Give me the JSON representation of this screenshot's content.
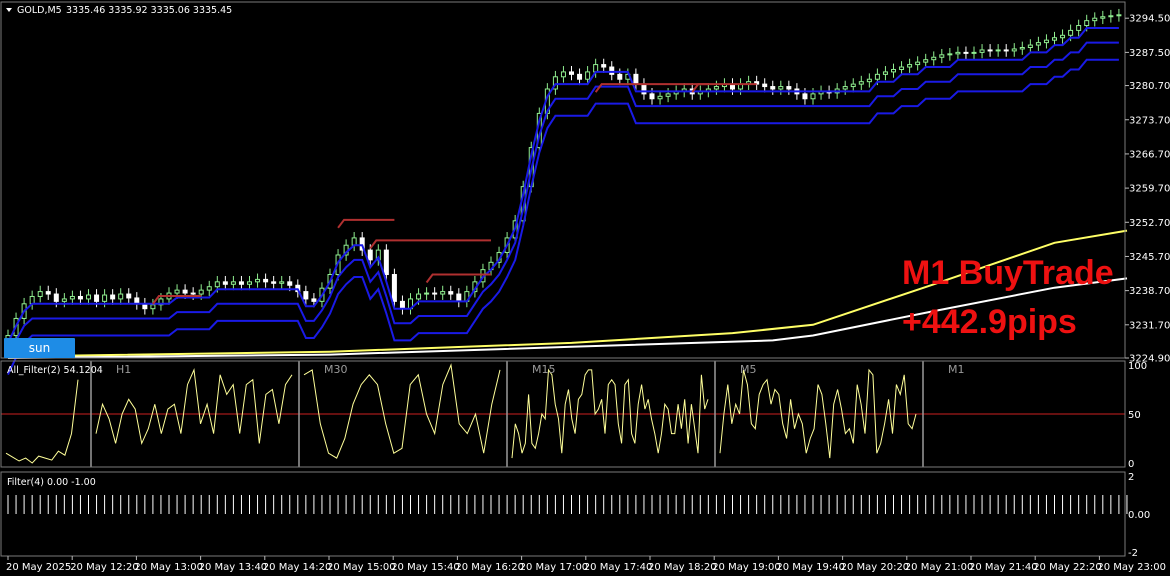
{
  "chart_header": {
    "symbol": "GOLD,M5",
    "ohlc": "3335.46 3335.92 3335.06 3335.45"
  },
  "overlay": {
    "line1": "M1 BuyTrade",
    "line2": "+442.9pips",
    "color": "#ee1111"
  },
  "sun_button": "sun",
  "colors": {
    "background": "#000000",
    "bull_candle": "#90ee90",
    "bear_candle": "#ffffff",
    "channel": "#1a1ae6",
    "channel_stop": "#b03030",
    "ma_slow_yellow": "#ffff66",
    "ma_slow_white": "#ffffff",
    "oscillator": "#ffff99",
    "oscillator_midline": "#cc2020"
  },
  "chart_data": [
    {
      "type": "line",
      "panel": "main",
      "price_axis": [
        "3294.50",
        "3287.50",
        "3280.70",
        "3273.70",
        "3266.70",
        "3259.70",
        "3252.70",
        "3245.70",
        "3238.70",
        "3231.70",
        "3224.90"
      ],
      "ylim": [
        3224.9,
        3297.0
      ],
      "time_axis": [
        "20 May 2025",
        "20 May 12:20",
        "20 May 13:00",
        "20 May 13:40",
        "20 May 14:20",
        "20 May 15:00",
        "20 May 15:40",
        "20 May 16:20",
        "20 May 17:00",
        "20 May 17:40",
        "20 May 18:20",
        "20 May 19:00",
        "20 May 19:40",
        "20 May 20:20",
        "20 May 21:00",
        "20 May 21:40",
        "20 May 22:20",
        "20 May 23:00"
      ],
      "candles_close": [
        3229.5,
        3233,
        3236,
        3237.5,
        3238.5,
        3238,
        3236.5,
        3237,
        3237.5,
        3237,
        3237.8,
        3236.5,
        3237.8,
        3237,
        3238,
        3237.2,
        3236,
        3235,
        3235.8,
        3237,
        3238.2,
        3238.8,
        3238.2,
        3238,
        3238.8,
        3239.5,
        3240.5,
        3240,
        3240.5,
        3240,
        3240.5,
        3241,
        3240.5,
        3240.2,
        3240.5,
        3239.8,
        3238.5,
        3237,
        3236.5,
        3239.2,
        3242,
        3246,
        3248,
        3249.5,
        3247,
        3245,
        3247,
        3242,
        3236.5,
        3235,
        3237,
        3238,
        3238.2,
        3238,
        3238.5,
        3238,
        3236.5,
        3238.5,
        3240.5,
        3243,
        3244.5,
        3246.5,
        3249.5,
        3253,
        3260,
        3268,
        3275,
        3280,
        3282.5,
        3283.5,
        3283,
        3282,
        3283.5,
        3285,
        3284.5,
        3283,
        3282,
        3283,
        3281,
        3279,
        3278,
        3278.5,
        3279,
        3279.5,
        3280,
        3279,
        3279.5,
        3280,
        3280.5,
        3281,
        3280,
        3281,
        3281.5,
        3281,
        3280.5,
        3280,
        3280.5,
        3280,
        3279,
        3278,
        3279,
        3279.5,
        3279.2,
        3280,
        3280.5,
        3281,
        3281.5,
        3282,
        3283,
        3283.5,
        3284,
        3284.5,
        3285,
        3285.5,
        3286,
        3286.5,
        3287,
        3287.2,
        3287.5,
        3287.3,
        3287.5,
        3288,
        3287.8,
        3288,
        3287.8,
        3288.2,
        3288.5,
        3289,
        3289.5,
        3290,
        3290.5,
        3291,
        3292,
        3293,
        3294,
        3294.5,
        3294.8,
        3295,
        3295.2
      ],
      "series": [
        {
          "name": "",
          "role": "ma-yellow",
          "points": [
            [
              0,
              3225.2
            ],
            [
              40,
              3226.2
            ],
            [
              70,
              3228
            ],
            [
              90,
              3230
            ],
            [
              100,
              3231.7
            ],
            [
              115,
              3240
            ],
            [
              130,
              3248.5
            ],
            [
              139,
              3251
            ]
          ]
        },
        {
          "name": "",
          "role": "ma-white",
          "points": [
            [
              0,
              3224.9
            ],
            [
              40,
              3225.6
            ],
            [
              70,
              3227.2
            ],
            [
              95,
              3228.5
            ],
            [
              100,
              3229.5
            ],
            [
              115,
              3234.5
            ],
            [
              130,
              3239.3
            ],
            [
              139,
              3241.2
            ]
          ]
        }
      ]
    },
    {
      "type": "line",
      "panel": "All_Filter",
      "title": "All_Filter(2) 54.1204",
      "timeframes": [
        "H1",
        "M30",
        "M15",
        "M5",
        "M1"
      ],
      "y_axis": [
        "100",
        "50",
        "0"
      ],
      "ylim": [
        0,
        100
      ],
      "midline": 50,
      "series": [
        {
          "name": "",
          "values": [
            10,
            6,
            2,
            5,
            0,
            7,
            5,
            3,
            12,
            8,
            30,
            85
          ]
        },
        {
          "name": "",
          "values": [
            30,
            60,
            45,
            20,
            50,
            65,
            55,
            20,
            35,
            60,
            30,
            55,
            60,
            30,
            80,
            95,
            40,
            60,
            30,
            90,
            70,
            80,
            30,
            80,
            85,
            20,
            70,
            75,
            40,
            80,
            90
          ]
        },
        {
          "name": "",
          "values": [
            90,
            95,
            40,
            10,
            5,
            25,
            60,
            80,
            90,
            80,
            40,
            10,
            15,
            80,
            90,
            50,
            30,
            80,
            100,
            40,
            30,
            50,
            10,
            60,
            95
          ]
        },
        {
          "name": "",
          "values": [
            5,
            40,
            30,
            10,
            20,
            70,
            20,
            15,
            30,
            50,
            45,
            95,
            90,
            60,
            45,
            10,
            60,
            75,
            45,
            30,
            65,
            70,
            90,
            95,
            95,
            50,
            55,
            65,
            30,
            80,
            85,
            80,
            40,
            20,
            80,
            85,
            30,
            20,
            60,
            80,
            55,
            65,
            45,
            30,
            10,
            30,
            60,
            55,
            30,
            30,
            60,
            35,
            65,
            20,
            60,
            35,
            10,
            90,
            55,
            65
          ]
        },
        {
          "name": "",
          "values": [
            10,
            50,
            80,
            40,
            60,
            50,
            95,
            80,
            40,
            35,
            70,
            80,
            85,
            60,
            75,
            70,
            40,
            25,
            65,
            35,
            50,
            40,
            10,
            25,
            35,
            80,
            70,
            40,
            5,
            60,
            75,
            55,
            30,
            35,
            20,
            80,
            60,
            30,
            95,
            90,
            10,
            20,
            40,
            65,
            30,
            80,
            70,
            90,
            40,
            35,
            50
          ]
        }
      ]
    },
    {
      "type": "bar",
      "panel": "Filter",
      "title": "Filter(4) 0.00 -1.00",
      "y_axis": [
        "2",
        "0.00",
        "-2"
      ],
      "ylim": [
        -2,
        2
      ],
      "bar_value": 1,
      "bar_count": 140
    }
  ]
}
